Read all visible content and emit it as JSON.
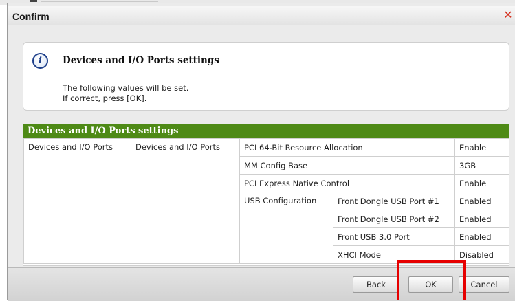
{
  "dialog": {
    "title": "Confirm",
    "close_glyph": "✕"
  },
  "info": {
    "icon": "info-icon",
    "icon_glyph": "i",
    "heading": "Devices and I/O Ports settings",
    "line1": "The following values will be set.",
    "line2": "If correct, press [OK]."
  },
  "table": {
    "header": "Devices and I/O Ports settings",
    "category": "Devices and I/O Ports",
    "subcategory": "Devices and I/O Ports",
    "rows": [
      {
        "setting": "PCI 64-Bit Resource Allocation",
        "value": "Enable"
      },
      {
        "setting": "MM Config Base",
        "value": "3GB"
      },
      {
        "setting": "PCI Express Native Control",
        "value": "Enable"
      }
    ],
    "usb_group": "USB Configuration",
    "usb_rows": [
      {
        "setting": "Front Dongle USB Port #1",
        "value": "Enabled"
      },
      {
        "setting": "Front Dongle USB Port #2",
        "value": "Enabled"
      },
      {
        "setting": "Front USB 3.0 Port",
        "value": "Enabled"
      },
      {
        "setting": "XHCI Mode",
        "value": "Disabled"
      }
    ]
  },
  "footer": {
    "back_label": "Back",
    "ok_label": "OK",
    "cancel_label": "Cancel"
  },
  "colors": {
    "header_green": "#4e8a16",
    "highlight_red": "#e60000",
    "close_red": "#d4301f"
  }
}
